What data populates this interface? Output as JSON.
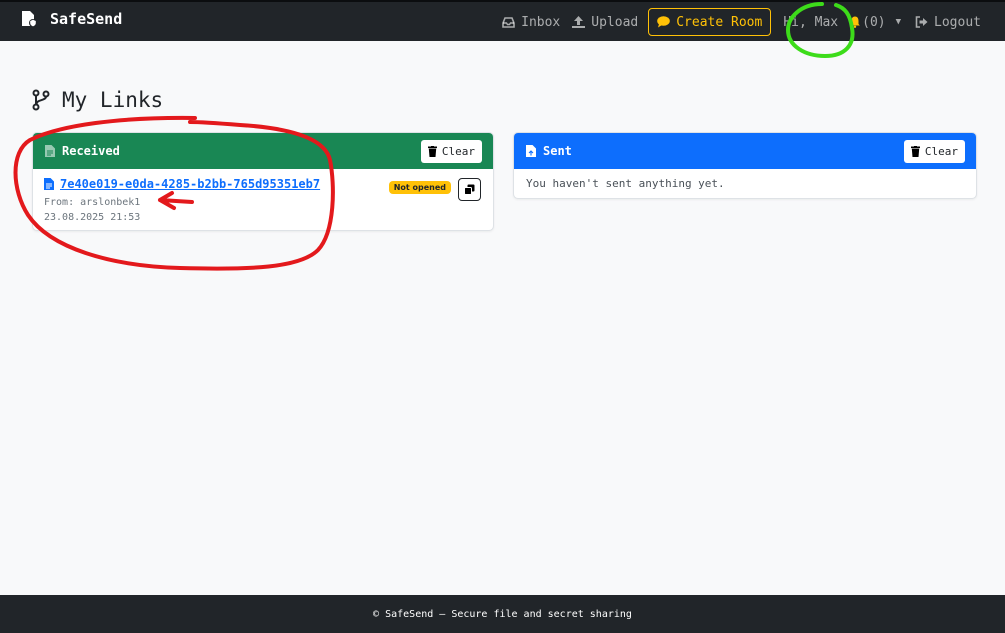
{
  "navbar": {
    "brand": "SafeSend",
    "inbox": "Inbox",
    "upload": "Upload",
    "create_room": "Create Room",
    "greeting": "Hi, Max",
    "notifications": "(0)",
    "logout": "Logout"
  },
  "page": {
    "title": "My Links"
  },
  "received": {
    "title": "Received",
    "clear_label": "Clear",
    "items": [
      {
        "link": "7e40e019-e0da-4285-b2bb-765d95351eb7",
        "from": "From: arslonbek1",
        "date": "23.08.2025 21:53",
        "status": "Not opened"
      }
    ]
  },
  "sent": {
    "title": "Sent",
    "clear_label": "Clear",
    "empty_message": "You haven't sent anything yet."
  },
  "footer": {
    "text": "© SafeSend — Secure file and secret sharing"
  },
  "colors": {
    "navbar": "#212529",
    "received_header": "#198754",
    "sent_header": "#0d6efd",
    "accent_warning": "#ffc107",
    "link": "#0d6efd",
    "annotation_red": "#e3191c",
    "annotation_green": "#3ddc1a"
  },
  "icons": [
    "safesend-logo-icon",
    "inbox-icon",
    "upload-icon",
    "chat-icon",
    "bell-icon",
    "logout-icon",
    "branch-icon",
    "file-icon",
    "trash-icon",
    "copy-icon"
  ]
}
